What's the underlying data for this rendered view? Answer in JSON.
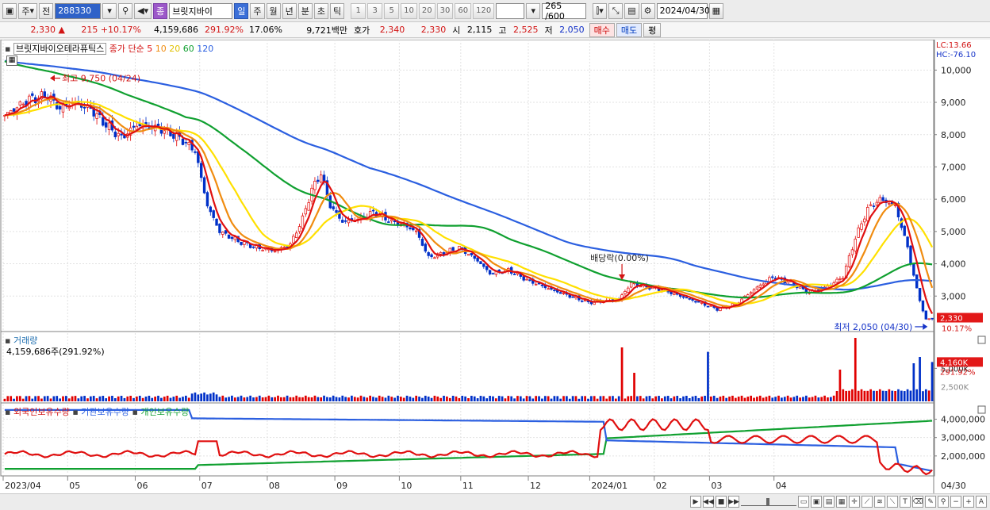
{
  "toolbar": {
    "market": "주",
    "prev_label": "전",
    "code": "288330",
    "name": "브릿지바이",
    "badge": "종",
    "periods": [
      "일",
      "주",
      "월",
      "년",
      "분",
      "초",
      "틱"
    ],
    "active_period": "일",
    "numbers": [
      "1",
      "3",
      "5",
      "10",
      "20",
      "30",
      "60",
      "120"
    ],
    "count_display": "265 /600",
    "date": "2024/04/30"
  },
  "infobar": {
    "price": "2,330",
    "change_arrow": "▲",
    "change": "215",
    "change_pct": "+10.17%",
    "volume": "4,159,686",
    "volume_pct": "291.92%",
    "turnover": "17.06%",
    "amount": "9,721백만",
    "ask_label": "호가",
    "ask": "2,340",
    "bid": "2,330",
    "open_label": "시",
    "open": "2,115",
    "high_label": "고",
    "high": "2,525",
    "low_label": "저",
    "low": "2,050",
    "buy_label": "매수",
    "sell_label": "매도",
    "eval_label": "평"
  },
  "price_panel": {
    "legend_name": "브릿지바이오테라퓨틱스",
    "ma_label": "종가 단순",
    "ma_periods": [
      "5",
      "10",
      "20",
      "60",
      "120"
    ],
    "lc": "LC:13.66",
    "hc": "HC:-76.10",
    "y_ticks": [
      "10,000",
      "9,000",
      "8,000",
      "7,000",
      "6,000",
      "5,000",
      "4,000",
      "3,000"
    ],
    "high_annot": "최고 9,750 (04/24)",
    "low_annot": "최저 2,050 (04/30)",
    "div_annot": "배당락(0.00%)",
    "last_price_tag": "2,330",
    "last_pct_tag": "10.17%"
  },
  "volume_panel": {
    "title": "거래량",
    "value": "4,159,686주(291.92%)",
    "tick": "5,000K",
    "last_tag": "4,160K",
    "last_pct": "291.92%",
    "sub_tick": "2,500K"
  },
  "holding_panel": {
    "series": [
      "외국인보유수량",
      "기관보유수량",
      "개인보유수량"
    ],
    "y_ticks": [
      "4,000,000",
      "3,000,000",
      "2,000,000"
    ]
  },
  "x_labels": [
    "2023/04",
    "05",
    "06",
    "07",
    "08",
    "09",
    "10",
    "11",
    "12",
    "2024/01",
    "02",
    "03",
    "04"
  ],
  "x_last": "04/30",
  "colors": {
    "ma5": "#e01010",
    "ma10": "#f08c10",
    "ma20": "#ffe000",
    "ma60": "#10a030",
    "ma120": "#2b5fe0",
    "up": "#e00000",
    "down": "#0030c8"
  },
  "chart_data": {
    "type": "candlestick",
    "title": "브릿지바이오테라퓨틱스",
    "y_range": [
      1950,
      10500
    ],
    "anchors_close": [
      [
        0,
        8600
      ],
      [
        8,
        9100
      ],
      [
        14,
        9200
      ],
      [
        18,
        8800
      ],
      [
        22,
        9000
      ],
      [
        28,
        8800
      ],
      [
        33,
        8300
      ],
      [
        38,
        7900
      ],
      [
        43,
        8300
      ],
      [
        50,
        8200
      ],
      [
        57,
        7900
      ],
      [
        62,
        7500
      ],
      [
        66,
        5800
      ],
      [
        70,
        5000
      ],
      [
        76,
        4700
      ],
      [
        82,
        4500
      ],
      [
        88,
        4400
      ],
      [
        93,
        4600
      ],
      [
        97,
        5400
      ],
      [
        100,
        6300
      ],
      [
        103,
        6800
      ],
      [
        106,
        5800
      ],
      [
        110,
        5300
      ],
      [
        116,
        5400
      ],
      [
        120,
        5600
      ],
      [
        126,
        5300
      ],
      [
        130,
        5200
      ],
      [
        134,
        5000
      ],
      [
        138,
        4200
      ],
      [
        142,
        4300
      ],
      [
        148,
        4500
      ],
      [
        154,
        4100
      ],
      [
        158,
        3700
      ],
      [
        164,
        3800
      ],
      [
        170,
        3500
      ],
      [
        178,
        3200
      ],
      [
        184,
        3000
      ],
      [
        190,
        2800
      ],
      [
        196,
        2850
      ],
      [
        200,
        2900
      ],
      [
        204,
        3400
      ],
      [
        208,
        3300
      ],
      [
        214,
        3200
      ],
      [
        220,
        3000
      ],
      [
        226,
        2800
      ],
      [
        232,
        2600
      ],
      [
        238,
        2750
      ],
      [
        244,
        3200
      ],
      [
        250,
        3600
      ],
      [
        256,
        3400
      ],
      [
        262,
        3100
      ],
      [
        268,
        3300
      ],
      [
        273,
        3600
      ],
      [
        277,
        4800
      ],
      [
        281,
        5700
      ],
      [
        285,
        6000
      ],
      [
        290,
        5800
      ],
      [
        294,
        4500
      ],
      [
        297,
        3200
      ],
      [
        300,
        2250
      ],
      [
        302,
        2330
      ]
    ],
    "volume_spikes": [
      [
        201,
        0.85
      ],
      [
        205,
        0.45
      ],
      [
        229,
        0.78
      ],
      [
        272,
        0.5
      ],
      [
        277,
        1.0
      ],
      [
        296,
        0.6
      ],
      [
        298,
        0.7
      ],
      [
        302,
        0.62
      ]
    ],
    "holdings": {
      "foreign_start": 2100000,
      "foreign_peak": 4250000,
      "foreign_end": 1200000,
      "institution_start": 4500000,
      "institution_end": 1200000,
      "individual_start": 1300000,
      "individual_end": 4400000
    }
  }
}
